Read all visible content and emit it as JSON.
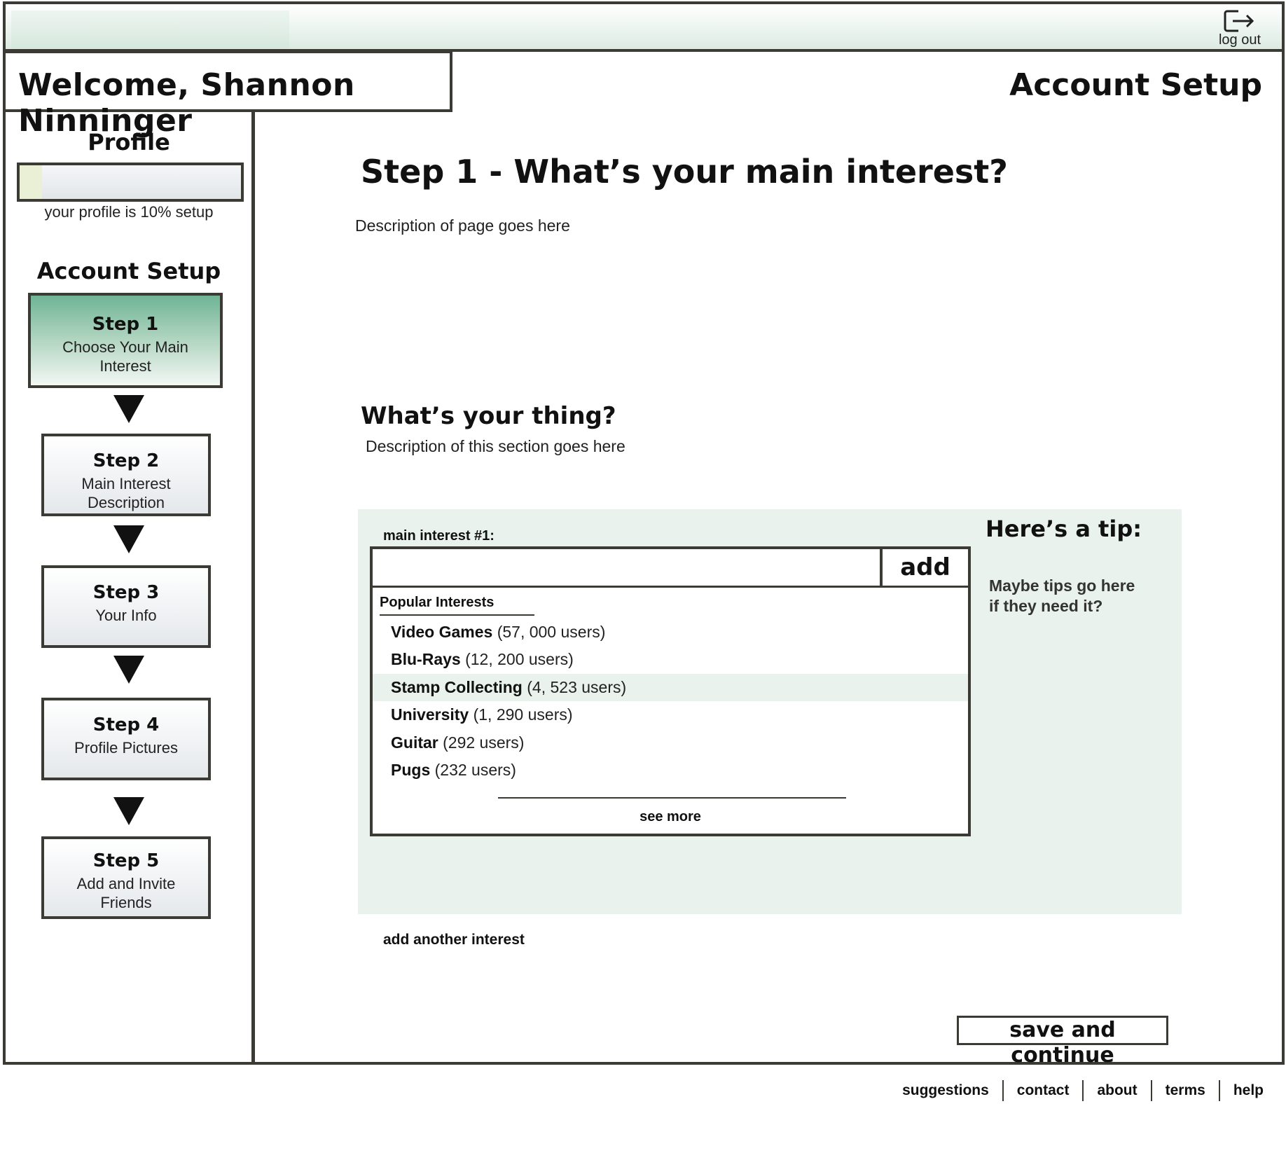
{
  "header": {
    "logout_label": "log out",
    "welcome": "Welcome, Shannon Ninninger",
    "page_title": "Account Setup"
  },
  "sidebar": {
    "profile_title": "Profile",
    "profile_progress_percent": 10,
    "profile_progress_text": "your profile is 10% setup",
    "setup_title": "Account Setup",
    "steps": [
      {
        "number": "Step 1",
        "description": "Choose Your Main Interest",
        "active": true
      },
      {
        "number": "Step 2",
        "description": "Main Interest Description",
        "active": false
      },
      {
        "number": "Step 3",
        "description": "Your Info",
        "active": false
      },
      {
        "number": "Step 4",
        "description": "Profile Pictures",
        "active": false
      },
      {
        "number": "Step 5",
        "description": "Add and Invite Friends",
        "active": false
      }
    ]
  },
  "main": {
    "title": "Step 1 - What’s your main interest?",
    "description": "Description of page goes here",
    "section_title": "What’s your thing?",
    "section_description": "Description of this section goes here",
    "interest_label": "main interest #1:",
    "interest_value": "",
    "add_label": "add",
    "popular_header": "Popular Interests",
    "popular_interests": [
      {
        "name": "Video Games",
        "count": "(57, 000 users)"
      },
      {
        "name": "Blu-Rays",
        "count": "(12, 200 users)"
      },
      {
        "name": "Stamp Collecting",
        "count": "(4, 523 users)"
      },
      {
        "name": "University",
        "count": "(1, 290 users)"
      },
      {
        "name": "Guitar",
        "count": "(292 users)"
      },
      {
        "name": "Pugs",
        "count": "(232 users)"
      }
    ],
    "highlighted_interest": "Stamp Collecting",
    "see_more": "see more",
    "tip_title": "Here’s a tip:",
    "tip_text": "Maybe tips go here if they need it?",
    "add_another": "add another interest",
    "save_label": "save and continue"
  },
  "footer": {
    "links": [
      "suggestions",
      "contact",
      "about",
      "terms",
      "help"
    ]
  },
  "icons": {
    "logout": "logout-icon"
  },
  "colors": {
    "active_step": "#6fb495",
    "panel_bg": "#e9f2ed",
    "border": "#3b3a35"
  }
}
